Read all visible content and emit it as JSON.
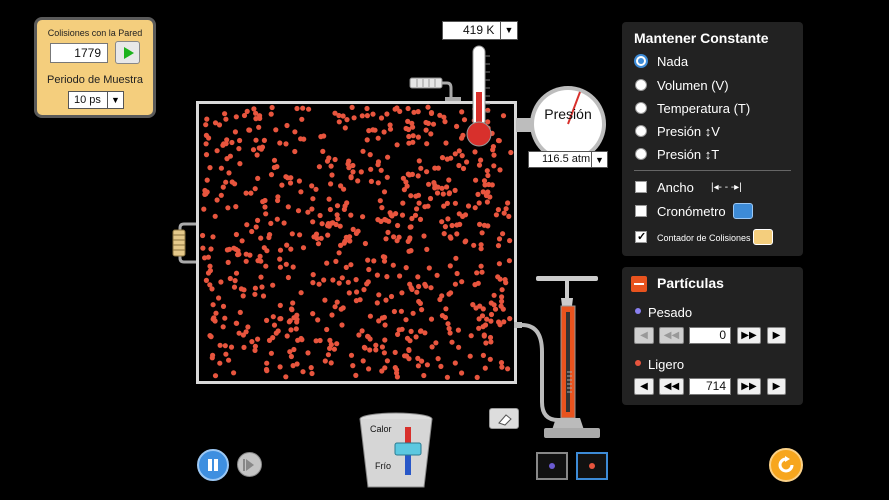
{
  "collision_counter": {
    "title": "Colisiones con la Pared",
    "count": "1779",
    "sample_period_label": "Periodo de Muestra",
    "sample_period_value": "10 ps"
  },
  "thermometer": {
    "readout": "419 K"
  },
  "pressure_gauge": {
    "label": "Presión",
    "readout": "116.5 atm"
  },
  "constant_panel": {
    "title": "Mantener Constante",
    "options": [
      {
        "label": "Nada",
        "selected": true
      },
      {
        "label": "Volumen (V)",
        "selected": false
      },
      {
        "label": "Temperatura (T)",
        "selected": false
      },
      {
        "label": "Presión ↕V",
        "selected": false
      },
      {
        "label": "Presión ↕T",
        "selected": false
      }
    ],
    "checkboxes": [
      {
        "label": "Ancho",
        "checked": false
      },
      {
        "label": "Cronómetro",
        "checked": false
      },
      {
        "label": "Contador de Colisiones",
        "checked": true
      }
    ]
  },
  "particles_panel": {
    "title": "Partículas",
    "heavy_label": "Pesado",
    "heavy_count": "0",
    "light_label": "Ligero",
    "light_count": "714"
  },
  "heat_control": {
    "hot_label": "Calor",
    "cold_label": "Frío"
  },
  "colors": {
    "accent": "#3d8bd7",
    "particle_light": "#e8553e",
    "particle_heavy": "#6b5bd2",
    "panel_bg": "#222222",
    "orange": "#e8531e"
  }
}
